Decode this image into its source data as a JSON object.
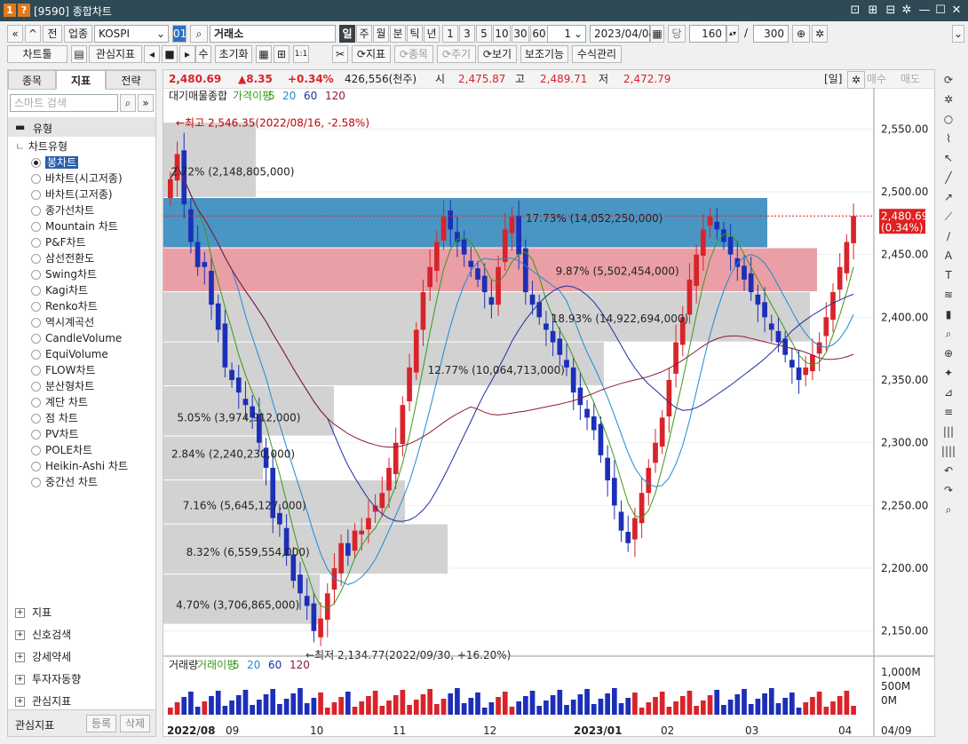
{
  "window": {
    "badge1": "1",
    "badge2": "?",
    "title": "[9590] 종합차트"
  },
  "toolbar1": {
    "market": "업종",
    "symbol": "KOSPI",
    "code_badge": "01",
    "name": "거래소",
    "periods": [
      "일",
      "주",
      "월",
      "분",
      "틱",
      "년"
    ],
    "intervals": [
      "1",
      "3",
      "5",
      "10",
      "30",
      "60"
    ],
    "count_value": "1",
    "date": "2023/04/04",
    "unit": "당",
    "bars": "160",
    "slash": "/",
    "max_bars": "300",
    "jeon_label": "전"
  },
  "toolbar2": {
    "chart_tool": "차트툴",
    "indicator_fav": "관심지표",
    "su": "수",
    "init": "초기화",
    "indicator": "지표",
    "stock": "종목",
    "cycle": "주기",
    "view": "보기",
    "aux": "보조기능",
    "formula": "수식관리"
  },
  "leftpanel": {
    "tabs": [
      "종목",
      "지표",
      "전략"
    ],
    "search_placeholder": "스마트 검색",
    "group_title": "유형",
    "tree_root": "차트유형",
    "chart_types": [
      "봉차트",
      "바차트(시고저종)",
      "바차트(고저종)",
      "종가선차트",
      "Mountain 차트",
      "P&F차트",
      "삼선전환도",
      "Swing차트",
      "Kagi차트",
      "Renko차트",
      "역시계곡선",
      "CandleVolume",
      "EquiVolume",
      "FLOW차트",
      "분산형차트",
      "계단 차트",
      "점 차트",
      "PV차트",
      "POLE차트",
      "Heikin-Ashi 차트",
      "중간선 차트"
    ],
    "bottom_items": [
      "지표",
      "신호검색",
      "강세약세",
      "투자자동향",
      "관심지표"
    ],
    "footer_label": "관심지표",
    "footer_register": "등록",
    "footer_delete": "삭제"
  },
  "infobar": {
    "price": "2,480.69",
    "change": "▲8.35",
    "change_pct": "+0.34%",
    "volume": "426,556(천주)",
    "open_label": "시",
    "open": "2,475.87",
    "high_label": "고",
    "high": "2,489.71",
    "low_label": "저",
    "low": "2,472.79",
    "period_tag": "[일]",
    "buy": "매수",
    "sell": "매도"
  },
  "price_legend": {
    "items": [
      "대기매물",
      "종합",
      "가격이평",
      "5",
      "20",
      "60",
      "120"
    ]
  },
  "volume_legend": {
    "items": [
      "거래량",
      "거래이평",
      "5",
      "20",
      "60",
      "120"
    ]
  },
  "price_axis": [
    "2,550.00",
    "2,500.00",
    "2,450.00",
    "2,400.00",
    "2,350.00",
    "2,300.00",
    "2,250.00",
    "2,200.00",
    "2,150.00"
  ],
  "volume_axis": [
    "1,000M",
    "500M",
    "0M"
  ],
  "x_axis": [
    "2022/08",
    "09",
    "10",
    "11",
    "12",
    "2023/01",
    "02",
    "03",
    "04"
  ],
  "x_axis_right": "04/09",
  "current_price_tag": {
    "price": "2,480.69",
    "pct": "(0.34%)"
  },
  "annotations": {
    "high": "←최고 2,546.35(2022/08/16, -2.58%)",
    "low": "←최저 2,134.77(2022/09/30, +16.20%)"
  },
  "volume_profile": [
    {
      "label": "2.72% (2,148,805,000)"
    },
    {
      "label": "17.73% (14,052,250,000)"
    },
    {
      "label": "9.87% (5,502,454,000)"
    },
    {
      "label": "18.93% (14,922,694,000)"
    },
    {
      "label": "12.77% (10,064,713,000)"
    },
    {
      "label": "5.05% (3,974,912,000)"
    },
    {
      "label": "2.84% (2,240,230,000)"
    },
    {
      "label": "7.16% (5,645,127,000)"
    },
    {
      "label": "8.32% (6,559,554,000)"
    },
    {
      "label": "4.70% (3,706,865,000)"
    }
  ],
  "colors": {
    "up": "#d9232a",
    "down": "#1c2fb8",
    "ma5": "#3a9a1a",
    "ma20": "#1e8ad6",
    "ma60": "#1d2fa0",
    "ma120": "#8b1a3a",
    "vp_blue": "#3f8fc0",
    "vp_pink": "#e89aa0",
    "vp_gray": "#d0d0d0"
  },
  "chart_data": {
    "type": "candlestick",
    "xlabel": "",
    "ylabel": "",
    "ylim": [
      2134.77,
      2560
    ],
    "categories": [
      "2022/08",
      "09",
      "10",
      "11",
      "12",
      "2023/01",
      "02",
      "03",
      "04"
    ],
    "series": [
      {
        "name": "종가",
        "values": [
          2510,
          2530,
          2490,
          2460,
          2440,
          2440,
          2410,
          2390,
          2360,
          2350,
          2340,
          2330,
          2320,
          2300,
          2280,
          2240,
          2235,
          2210,
          2190,
          2180,
          2170,
          2150,
          2160,
          2180,
          2200,
          2220,
          2210,
          2230,
          2230,
          2240,
          2250,
          2260,
          2280,
          2300,
          2330,
          2360,
          2390,
          2420,
          2440,
          2460,
          2480,
          2470,
          2460,
          2450,
          2440,
          2430,
          2420,
          2410,
          2440,
          2470,
          2480,
          2450,
          2420,
          2410,
          2400,
          2390,
          2380,
          2370,
          2360,
          2340,
          2330,
          2320,
          2310,
          2290,
          2270,
          2250,
          2230,
          2220,
          2240,
          2260,
          2280,
          2300,
          2320,
          2350,
          2380,
          2400,
          2430,
          2450,
          2470,
          2480,
          2470,
          2460,
          2450,
          2440,
          2430,
          2420,
          2410,
          2400,
          2390,
          2380,
          2370,
          2360,
          2350,
          2360,
          2370,
          2380,
          2400,
          2420,
          2440,
          2460,
          2480.69
        ]
      }
    ],
    "high_marker": 2546.35,
    "low_marker": 2134.77,
    "moving_averages": [
      "5",
      "20",
      "60",
      "120"
    ]
  }
}
